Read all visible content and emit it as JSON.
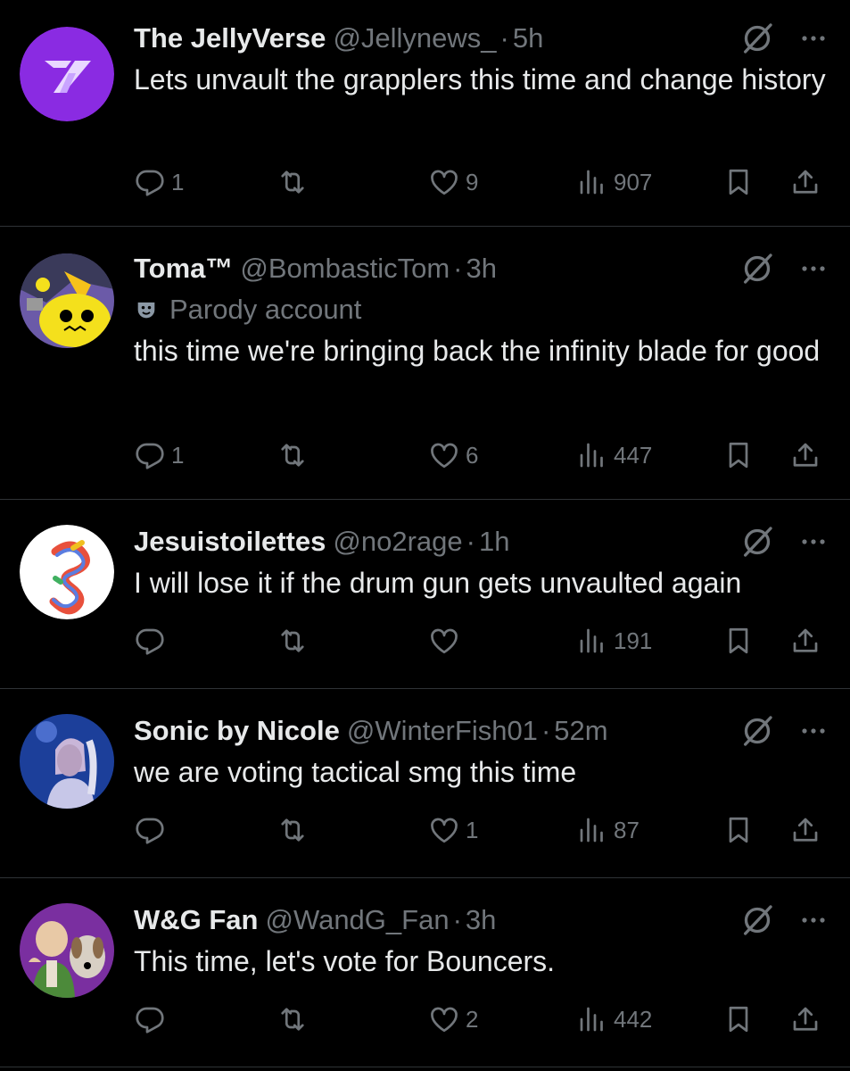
{
  "tweets": [
    {
      "name": "The JellyVerse",
      "handle": "@Jellynews_",
      "dot": "·",
      "time": "5h",
      "parody": "",
      "text": "Lets unvault the grapplers this time and change history",
      "replies": "1",
      "reposts": "",
      "likes": "9",
      "views": "907",
      "avatar": "jellyverse-logo"
    },
    {
      "name": "Toma™",
      "handle": "@BombasticTom",
      "dot": "·",
      "time": "3h",
      "parody": "Parody account",
      "text": "this time we're bringing back the infinity blade for good",
      "replies": "1",
      "reposts": "",
      "likes": "6",
      "views": "447",
      "avatar": "yellow-cartoon-character"
    },
    {
      "name": "Jesuistoilettes",
      "handle": "@no2rage",
      "dot": "·",
      "time": "1h",
      "parody": "",
      "text": "I will lose it if the drum gun gets unvaulted again",
      "replies": "",
      "reposts": "",
      "likes": "",
      "views": "191",
      "avatar": "rainbow-letter-g"
    },
    {
      "name": "Sonic by Nicole",
      "handle": "@WinterFish01",
      "dot": "·",
      "time": "52m",
      "parody": "",
      "text": "we are voting tactical smg this time",
      "replies": "",
      "reposts": "",
      "likes": "1",
      "views": "87",
      "avatar": "person-portrait-blue"
    },
    {
      "name": "W&G Fan",
      "handle": "@WandG_Fan",
      "dot": "·",
      "time": "3h",
      "parody": "",
      "text": "This time, let's vote for Bouncers.",
      "replies": "",
      "reposts": "",
      "likes": "2",
      "views": "442",
      "avatar": "wallace-and-gromit"
    }
  ],
  "colors": {
    "background": "#000000",
    "text": "#e7e9ea",
    "muted": "#71767b",
    "divider": "#2f3336"
  }
}
